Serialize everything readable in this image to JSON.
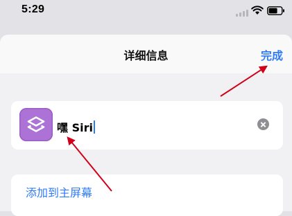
{
  "status_bar": {
    "time": "5:29"
  },
  "nav": {
    "title": "详细信息",
    "done_label": "完成"
  },
  "shortcut": {
    "icon": "shortcuts-icon",
    "name_value": "嘿 Siri"
  },
  "actions": {
    "add_to_home_label": "添加到主屏幕"
  },
  "colors": {
    "accent": "#2f7bf6",
    "icon_tile": "#ad72d6",
    "annotation": "#d0021b"
  }
}
